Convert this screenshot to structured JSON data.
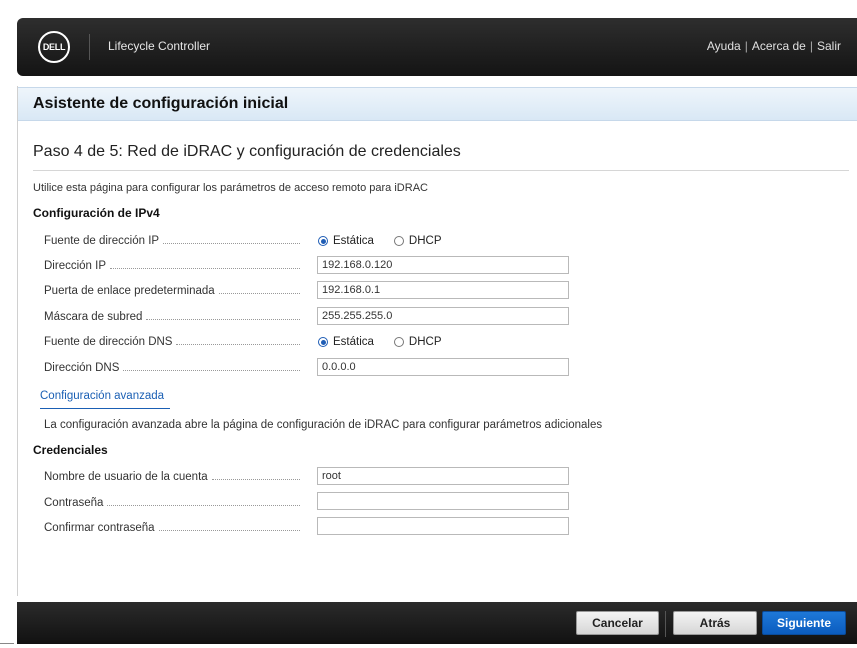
{
  "header": {
    "logo_text": "DELL",
    "app_title": "Lifecycle Controller",
    "links": [
      "Ayuda",
      "Acerca de",
      "Salir"
    ],
    "separator": "|"
  },
  "wizard": {
    "title": "Asistente de configuración inicial",
    "step_title": "Paso 4 de 5: Red de iDRAC y configuración de credenciales",
    "description": "Utilice esta página para configurar los parámetros de acceso remoto para iDRAC"
  },
  "ipv4": {
    "section_title": "Configuración de IPv4",
    "ip_source": {
      "label": "Fuente de dirección IP",
      "options": [
        "Estática",
        "DHCP"
      ],
      "selected": "Estática"
    },
    "ip_address": {
      "label": "Dirección IP",
      "value": "192.168.0.120"
    },
    "gateway": {
      "label": "Puerta de enlace predeterminada",
      "value": "192.168.0.1"
    },
    "subnet": {
      "label": "Máscara de subred",
      "value": "255.255.255.0"
    },
    "dns_source": {
      "label": "Fuente de dirección  DNS",
      "options": [
        "Estática",
        "DHCP"
      ],
      "selected": "Estática"
    },
    "dns_address": {
      "label": "Dirección DNS",
      "value": "0.0.0.0"
    }
  },
  "advanced": {
    "link_label": "Configuración avanzada",
    "note": "La configuración avanzada abre la página de configuración de iDRAC para configurar parámetros adicionales"
  },
  "credentials": {
    "section_title": "Credenciales",
    "username": {
      "label": "Nombre de usuario de la cuenta",
      "value": "root"
    },
    "password": {
      "label": "Contraseña",
      "value": ""
    },
    "confirm": {
      "label": "Confirmar contraseña",
      "value": ""
    }
  },
  "footer": {
    "cancel": "Cancelar",
    "back": "Atrás",
    "next": "Siguiente"
  },
  "colors": {
    "accent": "#0b5cbf",
    "link": "#1a5fb4",
    "header_bg": "#1a1a1a"
  }
}
